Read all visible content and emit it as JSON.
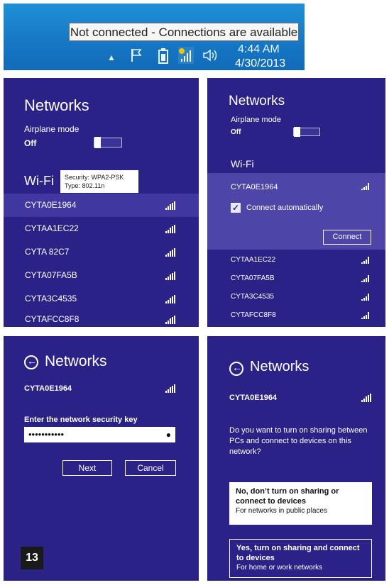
{
  "taskbar": {
    "tooltip": "Not connected - Connections are available",
    "time": "4:44 AM",
    "date": "4/30/2013",
    "icons": [
      "show-hidden-icons-icon",
      "flag-icon",
      "battery-icon",
      "network-no-internet-icon",
      "speaker-icon"
    ]
  },
  "panel1": {
    "title": "Networks",
    "airplane_label": "Airplane mode",
    "airplane_value": "Off",
    "wifi_label": "Wi-Fi",
    "tooltip_security": "Security: WPA2-PSK",
    "tooltip_type": "Type: 802.11n",
    "networks": [
      "CYTA0E1964",
      "CYTAA1EC22",
      "CYTA 82C7",
      "CYTA07FA5B",
      "CYTA3C4535",
      "CYTAFCC8F8"
    ]
  },
  "panel2": {
    "title": "Networks",
    "airplane_label": "Airplane mode",
    "airplane_value": "Off",
    "wifi_label": "Wi-Fi",
    "selected_network": "CYTA0E1964",
    "connect_auto_label": "Connect automatically",
    "connect_button": "Connect",
    "networks": [
      "CYTAA1EC22",
      "CYTA07FA5B",
      "CYTA3C4535",
      "CYTAFCC8F8"
    ]
  },
  "panel3": {
    "title": "Networks",
    "network": "CYTA0E1964",
    "key_label": "Enter the network security key",
    "key_value": "•••••••••••",
    "next_button": "Next",
    "cancel_button": "Cancel",
    "step_badge": "13"
  },
  "panel4": {
    "title": "Networks",
    "network": "CYTA0E1964",
    "question": "Do you want to turn on sharing between PCs and connect to devices on this network?",
    "option_no_title": "No, don’t turn on sharing or connect to devices",
    "option_no_sub": "For networks in public places",
    "option_yes_title": "Yes, turn on sharing and connect to devices",
    "option_yes_sub": "For home or work networks"
  }
}
